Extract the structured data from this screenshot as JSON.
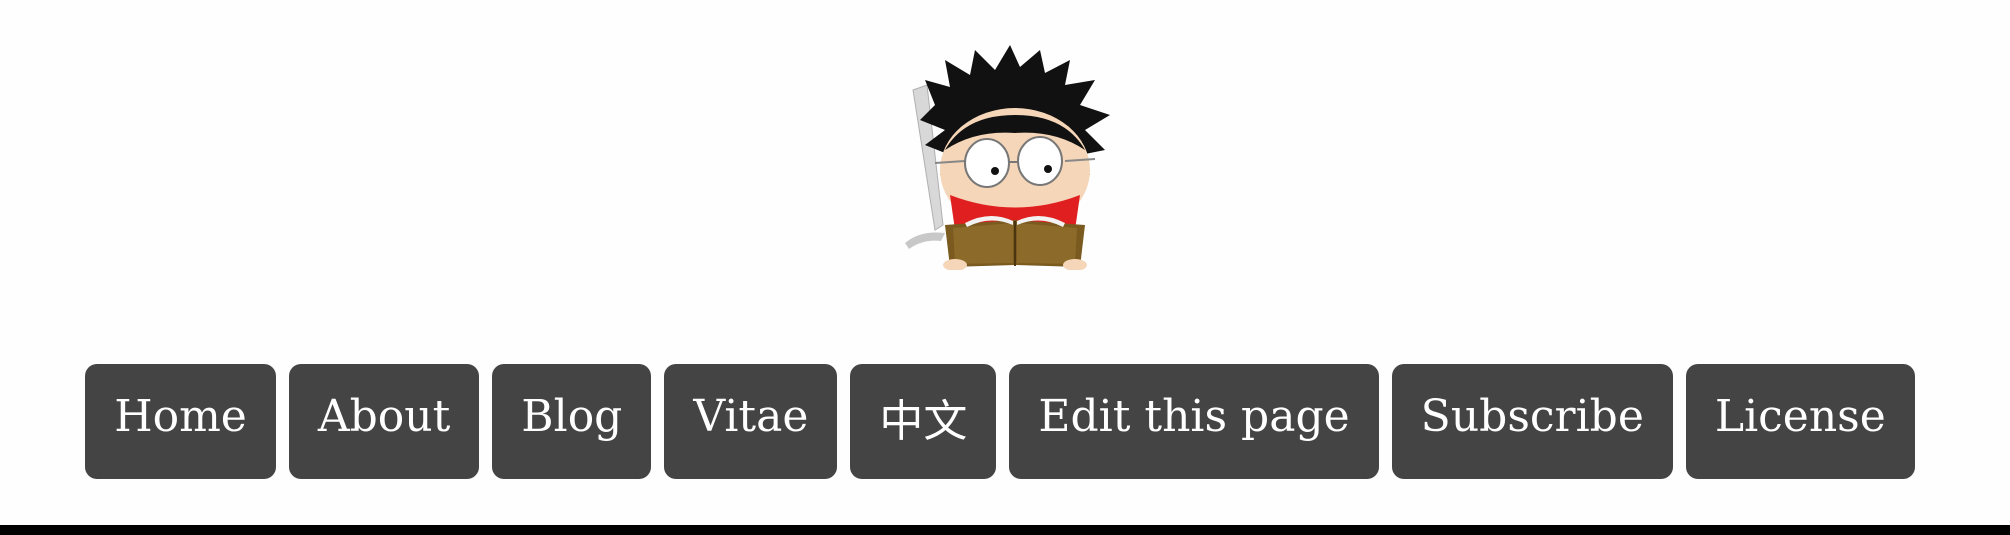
{
  "header": {
    "avatar_icon": "cartoon-reader-avatar-icon"
  },
  "nav": {
    "items": [
      {
        "label": "Home"
      },
      {
        "label": "About"
      },
      {
        "label": "Blog"
      },
      {
        "label": "Vitae"
      },
      {
        "label": "中文"
      },
      {
        "label": "Edit this page"
      },
      {
        "label": "Subscribe"
      },
      {
        "label": "License"
      }
    ]
  },
  "colors": {
    "button_bg": "#444444",
    "button_text": "#ffffff",
    "page_bg": "#fefefe",
    "footer_bar": "#000000"
  }
}
